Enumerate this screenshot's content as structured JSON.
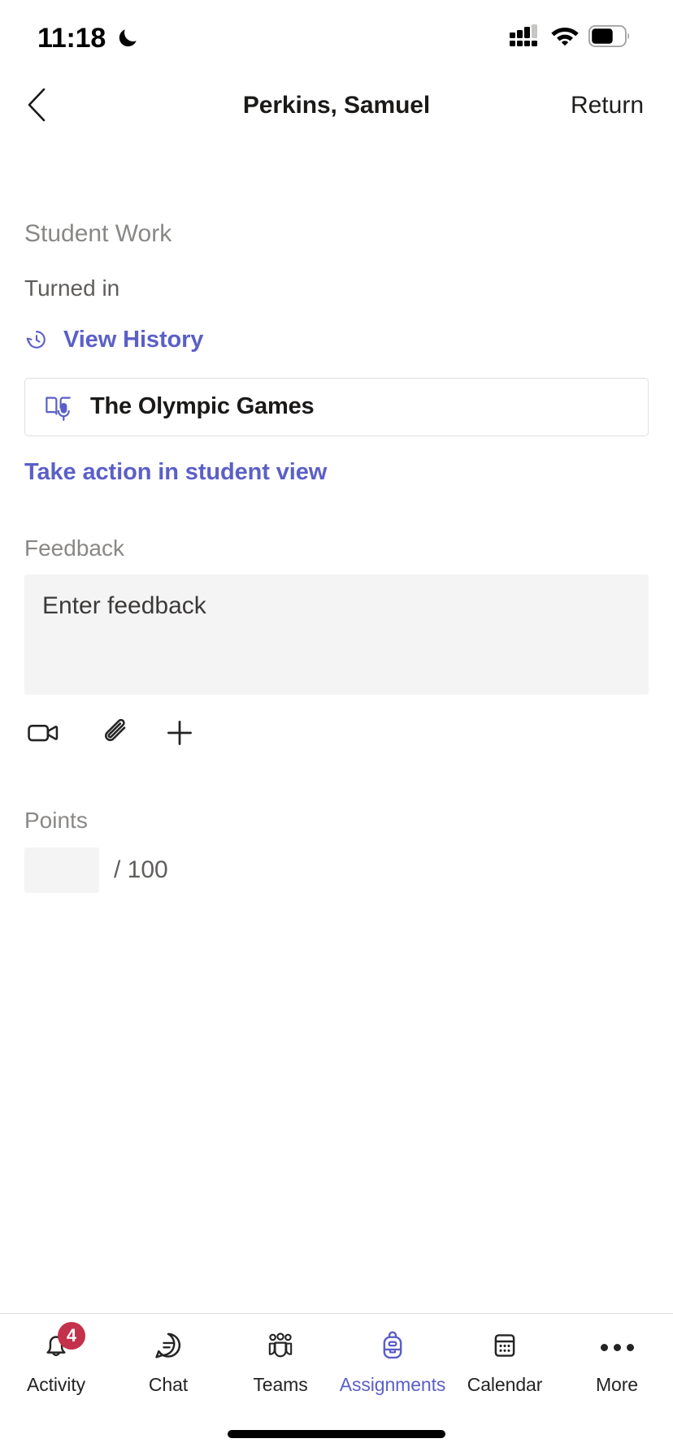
{
  "status_bar": {
    "time": "11:18",
    "dnd_icon": "moon-icon",
    "cellular_icon": "cellular-signal-icon",
    "wifi_icon": "wifi-icon",
    "battery_icon": "battery-icon",
    "battery_level_pct": 65,
    "signal_bars_filled": 3,
    "signal_bars_total": 4
  },
  "header": {
    "back_icon": "chevron-left-icon",
    "title": "Perkins, Samuel",
    "return_label": "Return"
  },
  "student_work": {
    "section_label": "Student Work",
    "status": "Turned in",
    "history": {
      "icon": "history-clock-icon",
      "label": "View History"
    },
    "work_item": {
      "icon": "reading-progress-book-mic-icon",
      "title": "The Olympic Games"
    },
    "student_view_link": "Take action in student view"
  },
  "feedback": {
    "label": "Feedback",
    "placeholder": "Enter feedback",
    "value": "",
    "toolbar": [
      {
        "name": "video-icon",
        "label": "Video"
      },
      {
        "name": "paperclip-icon",
        "label": "Attach"
      },
      {
        "name": "plus-icon",
        "label": "More options"
      }
    ]
  },
  "points": {
    "label": "Points",
    "value": "",
    "placeholder": "",
    "total": "/ 100"
  },
  "bottom_nav": {
    "active_index": 3,
    "items": [
      {
        "label": "Activity",
        "icon": "bell-icon",
        "badge": "4"
      },
      {
        "label": "Chat",
        "icon": "chat-bubble-icon",
        "badge": ""
      },
      {
        "label": "Teams",
        "icon": "teams-people-icon",
        "badge": ""
      },
      {
        "label": "Assignments",
        "icon": "backpack-icon",
        "badge": ""
      },
      {
        "label": "Calendar",
        "icon": "calendar-icon",
        "badge": ""
      },
      {
        "label": "More",
        "icon": "more-dots-icon",
        "badge": ""
      }
    ]
  },
  "colors": {
    "accent": "#5b5fc7",
    "badge": "#c4314b",
    "muted_text": "#8a8886",
    "field_bg": "#f5f4f4"
  }
}
